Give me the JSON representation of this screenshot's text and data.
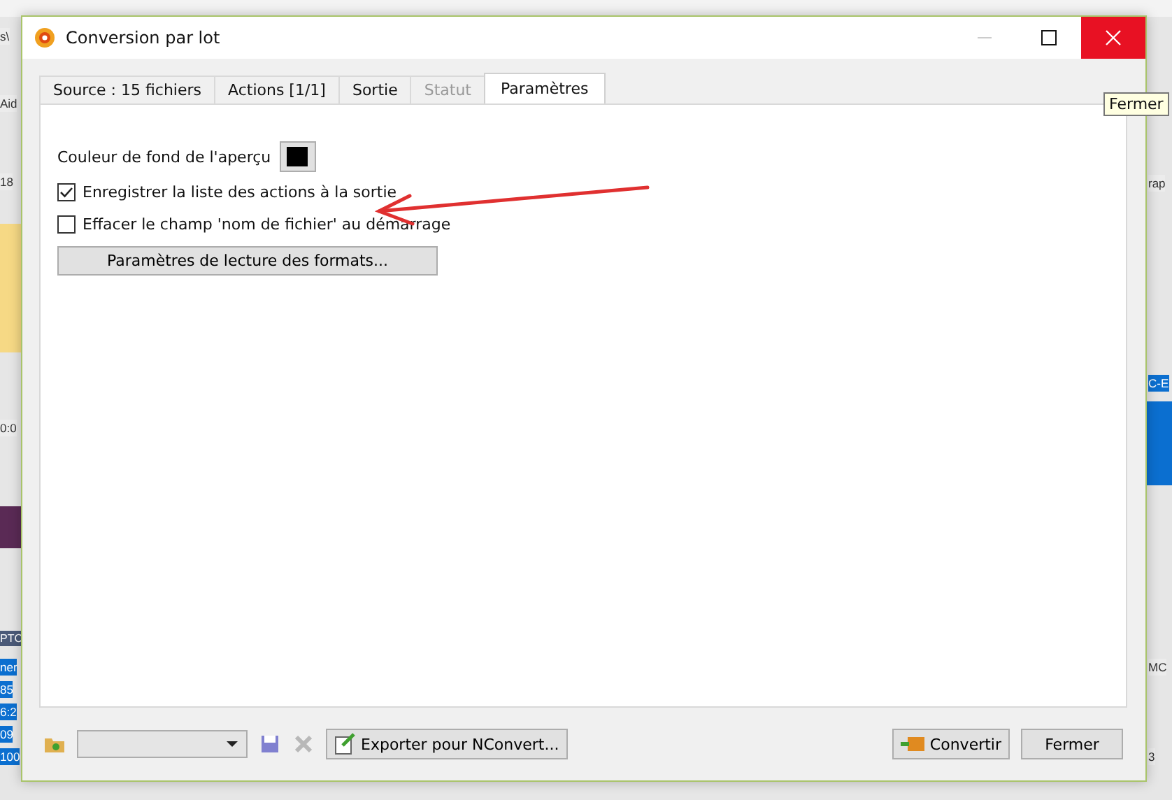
{
  "background_window": {
    "left_texts": [
      "s\\",
      "Aid",
      "18",
      "0:0",
      "PTC",
      "ner",
      "85",
      "6:2",
      "09",
      "100"
    ],
    "right_texts": [
      "rap",
      "C-E",
      "MC",
      "3"
    ]
  },
  "window": {
    "title": "Conversion par lot"
  },
  "tooltip": {
    "text": "Fermer"
  },
  "tabs": [
    {
      "label": "Source : 15 fichiers",
      "selected": false,
      "disabled": false
    },
    {
      "label": "Actions [1/1]",
      "selected": false,
      "disabled": false
    },
    {
      "label": "Sortie",
      "selected": false,
      "disabled": false
    },
    {
      "label": "Statut",
      "selected": false,
      "disabled": true
    },
    {
      "label": "Paramètres",
      "selected": true,
      "disabled": false
    }
  ],
  "settings": {
    "preview_background": {
      "label": "Couleur de fond de l'aperçu",
      "color": "#000000"
    },
    "options": [
      {
        "label": "Enregistrer la liste des actions à la sortie",
        "checked": true
      },
      {
        "label": "Effacer le champ 'nom de fichier' au démarrage",
        "checked": false
      }
    ],
    "format_button": "Paramètres de lecture des formats..."
  },
  "bottom_bar": {
    "export_button": "Exporter pour NConvert...",
    "convert_button": "Convertir",
    "close_button": "Fermer"
  }
}
